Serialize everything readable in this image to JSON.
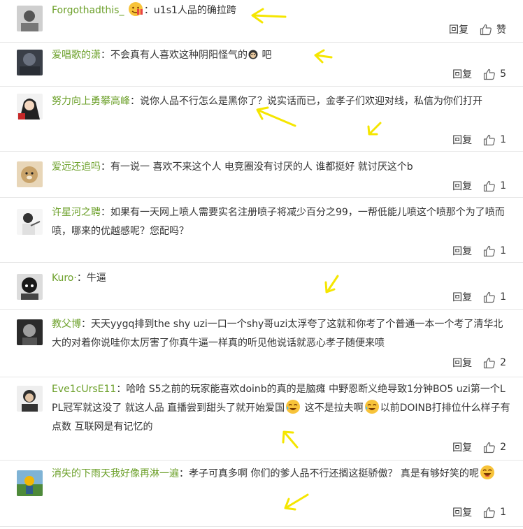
{
  "colors": {
    "username": "#6ca02a",
    "text": "#333333",
    "divider": "#e6e6e6",
    "arrow": "#f5e600"
  },
  "comments": [
    {
      "user": "Forgothadthis_",
      "prefix_emoji": "gift-emoji",
      "colon": "：",
      "text": "u1s1人品的确拉跨",
      "reply": "回复",
      "likes": "赞"
    },
    {
      "user": "爱唱歌的潇",
      "colon": "：",
      "text": "不会真有人喜欢这种阴阳怪气的",
      "inline_emoji": "monkey-emoji",
      "text_after": " 吧",
      "reply": "回复",
      "likes": "5"
    },
    {
      "user": "努力向上勇攀高峰",
      "colon": "：",
      "text": "说你人品不行怎么是黑你了？说实话而已，金孝子们欢迎对线，私信为你们打开",
      "reply": "回复",
      "likes": "1"
    },
    {
      "user": "爱远还追吗",
      "colon": "：",
      "text": "有一说一  喜欢不来这个人  电竞圈没有讨厌的人 谁都挺好   就讨厌这个b",
      "reply": "回复",
      "likes": "1"
    },
    {
      "user": "许星河之聘",
      "colon": "：",
      "text": "如果有一天网上喷人需要实名注册喷子将减少百分之99，一帮低能儿喷这个喷那个为了喷而喷，哪来的优越感呢？您配吗？",
      "reply": "回复",
      "likes": "1"
    },
    {
      "user": "Kuro·",
      "colon": "：",
      "text": "牛逼",
      "reply": "回复",
      "likes": "1"
    },
    {
      "user": "教父博",
      "colon": "：",
      "text": "天天yygq排到the shy uzi一口一个shy哥uzi太浮夸了这就和你考了个普通一本一个考了清华北大的对着你说哇你太厉害了你真牛逼一样真的听见他说话就恶心孝子随便来喷",
      "reply": "回复",
      "likes": "2"
    },
    {
      "user": "Eve1cUrsE11",
      "colon": "：",
      "text": "哈哈 S5之前的玩家能喜欢doinb的真的是脑瘫 中野恩断义绝导致1分钟BO5 uzi第一个LPL冠军就这没了 就这人品 直播尝到甜头了就开始爱国",
      "inline_emoji": "tear-smile-emoji",
      "text_after": " 这不是拉夫啊",
      "text_after2": "以前DOINB打排位什么样子有点数 互联网是有记忆的",
      "reply": "回复",
      "likes": "2"
    },
    {
      "user": "消失的下雨天我好像再淋一遍",
      "colon": "：",
      "text": "孝子可真多啊 你们的爹人品不行还搁这挺骄傲？ 真是有够好笑的呢",
      "inline_emoji": "laugh-emoji",
      "reply": "回复",
      "likes": "1"
    }
  ]
}
